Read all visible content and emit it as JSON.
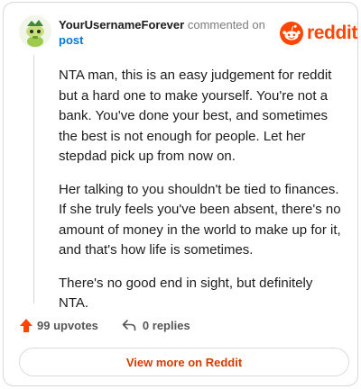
{
  "comment": {
    "username": "YourUsernameForever",
    "action_text": "commented on",
    "post_link": "post",
    "paragraphs": [
      "NTA man, this is an easy judgement for reddit but a hard one to make yourself. You're not a bank. You've done your best, and sometimes the best is not enough for people. Let her stepdad pick up from now on.",
      "Her talking to you shouldn't be tied to finances. If she truly feels you've been absent, there's no amount of money in the world to make up for it, and that's how life is sometimes.",
      "There's no good end in sight, but definitely NTA."
    ]
  },
  "brand": {
    "wordmark": "reddit",
    "color": "#ff4500",
    "icon": "reddit-snoo-icon"
  },
  "actions": {
    "upvotes": "99 upvotes",
    "replies": "0 replies",
    "upvote_icon": "upvote-arrow-icon",
    "reply_icon": "reply-arrow-icon",
    "upvote_color": "#ff4500"
  },
  "footer": {
    "view_more_label": "View more on Reddit",
    "accent": "#d93a00"
  }
}
